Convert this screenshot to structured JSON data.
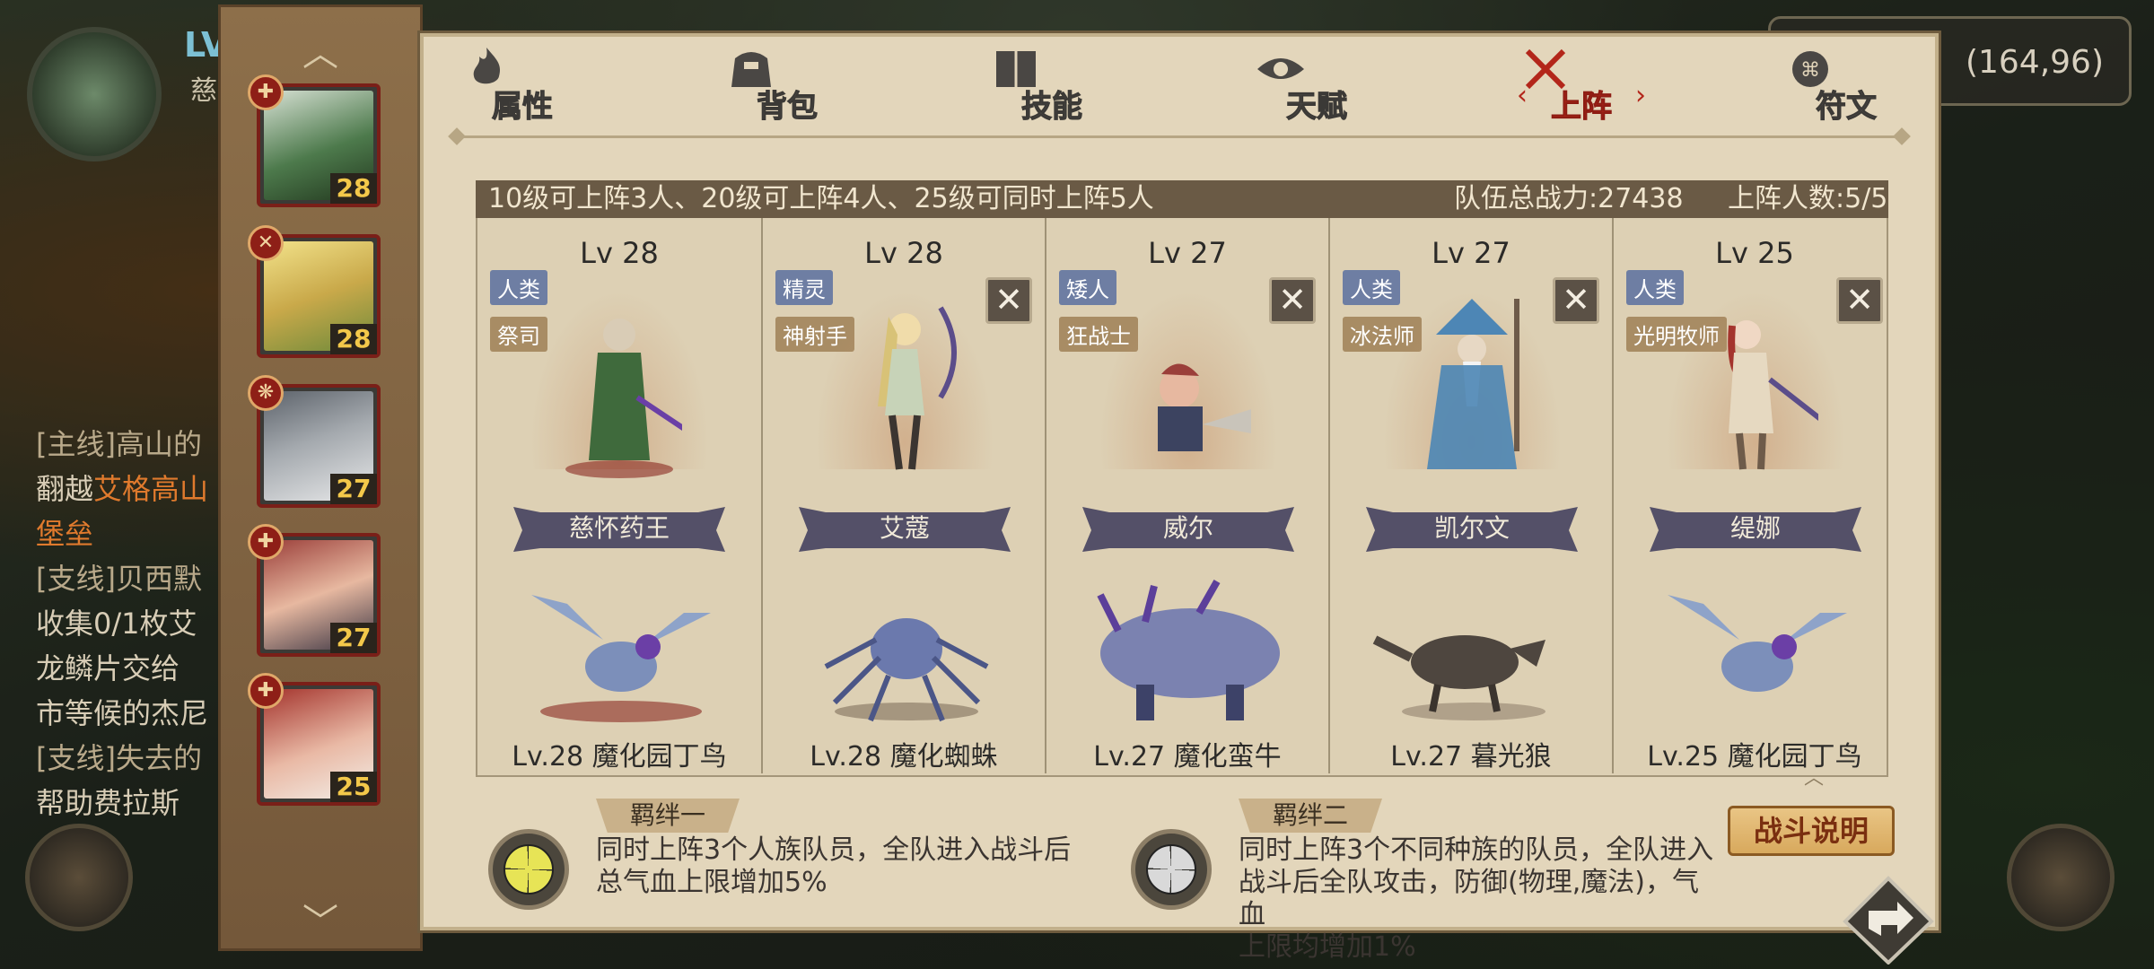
{
  "hud": {
    "level_label": "LV",
    "name_fragment": "慈",
    "coords": "(164,96)"
  },
  "quests": [
    {
      "title": "[主线]高山的",
      "body_pre": "翻越",
      "body_hl": "艾格高山",
      "body_hl2": "堡垒"
    },
    {
      "title": "[支线]贝西默",
      "body": "收集0/1枚艾",
      "body2": "龙鳞片交给",
      "body3": "市等候的杰尼"
    },
    {
      "title": "[支线]失去的",
      "body": "帮助费拉斯"
    }
  ],
  "side_heroes": [
    {
      "lv": "28",
      "badge": "✚",
      "color": "#4d7a4c"
    },
    {
      "lv": "28",
      "badge": "✕",
      "color": "#c9a94a"
    },
    {
      "lv": "27",
      "badge": "❋",
      "color": "#8a8f95"
    },
    {
      "lv": "27",
      "badge": "✚",
      "color": "#8a3b37"
    },
    {
      "lv": "25",
      "badge": "✚",
      "color": "#b55a52"
    }
  ],
  "tabs": [
    {
      "label": "属性",
      "icon": "flame-icon"
    },
    {
      "label": "背包",
      "icon": "bag-icon"
    },
    {
      "label": "技能",
      "icon": "book-icon"
    },
    {
      "label": "天赋",
      "icon": "eye-icon"
    },
    {
      "label": "上阵",
      "icon": "crossed-swords-icon"
    },
    {
      "label": "符文",
      "icon": "rune-icon"
    }
  ],
  "info": {
    "rule": "10级可上阵3人、20级可上阵4人、25级可同时上阵5人",
    "power": "队伍总战力:27438",
    "count": "上阵人数:5/5"
  },
  "lineup": [
    {
      "lv": "Lv 28",
      "race": "人类",
      "class": "祭司",
      "name": "慈怀药王",
      "pet": "Lv.28 魔化园丁鸟",
      "removable": false,
      "hero_color": "#3f6a3c",
      "pet_color": "#8ea3c9"
    },
    {
      "lv": "Lv 28",
      "race": "精灵",
      "class": "神射手",
      "name": "艾蔻",
      "pet": "Lv.28 魔化蜘蛛",
      "removable": true,
      "hero_color": "#d8c277",
      "pet_color": "#6b79ad"
    },
    {
      "lv": "Lv 27",
      "race": "矮人",
      "class": "狂战士",
      "name": "威尔",
      "pet": "Lv.27 魔化蛮牛",
      "removable": true,
      "hero_color": "#3c4360",
      "pet_color": "#7b82b0"
    },
    {
      "lv": "Lv 27",
      "race": "人类",
      "class": "冰法师",
      "name": "凯尔文",
      "pet": "Lv.27 暮光狼",
      "removable": true,
      "hero_color": "#4d86b5",
      "pet_color": "#4e463f"
    },
    {
      "lv": "Lv 25",
      "race": "人类",
      "class": "光明牧师",
      "name": "缇娜",
      "pet": "Lv.25 魔化园丁鸟",
      "removable": true,
      "hero_color": "#e6d9c1",
      "pet_color": "#8ea3c9"
    }
  ],
  "remove_symbol": "✕",
  "bonds": [
    {
      "title": "羁绊一",
      "lines": [
        "同时上阵3个人族队员，全队进入战斗后",
        "总气血上限增加5%"
      ],
      "color": "#e7e456"
    },
    {
      "title": "羁绊二",
      "lines": [
        "同时上阵3个不同种族的队员，全队进入",
        "战斗后全队攻击，防御(物理,魔法)，气血",
        "上限均增加1%"
      ],
      "color": "#d9d9d9"
    }
  ],
  "battle_button": "战斗说明",
  "colors": {
    "accent_red": "#b3261a",
    "panel_bg": "#e3d6bb",
    "info_bar": "#6a5a45",
    "level_gold": "#f3c84a"
  }
}
